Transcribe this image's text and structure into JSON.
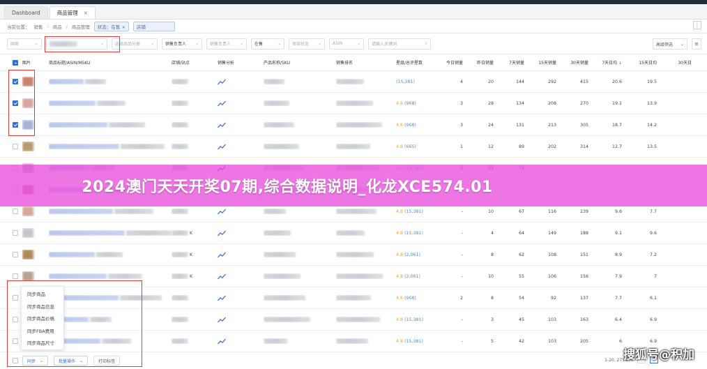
{
  "tabs": [
    {
      "label": "Dashboard",
      "active": false
    },
    {
      "label": "商品管理",
      "active": true,
      "close": "×"
    }
  ],
  "breadcrumb": {
    "items": [
      "当前位置：",
      "销售",
      "/",
      "商品",
      "/",
      "商品管理"
    ],
    "chips": [
      "状态：在售 ×",
      "店铺"
    ]
  },
  "filters": {
    "site_placeholder": "国家",
    "store_placeholder": "",
    "category_placeholder": "选择商品分类",
    "sales_owner": "销售负责人",
    "product_owner": "销售负责人",
    "status": "在售",
    "review_status": "审核状态",
    "asin_label": "ASIN",
    "search_placeholder": "请输入关键词",
    "advanced": "高级筛选",
    "menu_icon": "≡"
  },
  "table": {
    "headers": {
      "image": "图片",
      "title": "商品标题/ASIN/MSKU",
      "store": "店铺/站点",
      "sales_analysis": "销售分析",
      "product_sku": "产品名称/SKU",
      "sales_rank": "销售排名",
      "rating": "星级/总评星数",
      "today": "今日销量",
      "yesterday": "昨日销量",
      "d7": "7天销量",
      "d15": "15天销量",
      "d30": "30天销量",
      "daily7": "7天日均",
      "daily15": "15天日均",
      "daily30": "30天日"
    },
    "rows": [
      {
        "checked": true,
        "rating": "",
        "count": "(15,381)",
        "today": "4",
        "yesterday": "20",
        "d7": "144",
        "d15": "292",
        "d30": "415",
        "daily7": "20.6",
        "daily15": "19.5",
        "store_suffix": "",
        "thumb": "#c9826e"
      },
      {
        "checked": true,
        "rating": "4.6",
        "count": "(968)",
        "today": "3",
        "yesterday": "28",
        "d7": "134",
        "d15": "208",
        "d30": "270",
        "daily7": "19.1",
        "daily15": "13.9",
        "store_suffix": "",
        "thumb": "#d8a6a0"
      },
      {
        "checked": true,
        "rating": "4.6",
        "count": "(968)",
        "today": "3",
        "yesterday": "24",
        "d7": "131",
        "d15": "213",
        "d30": "305",
        "daily7": "18.7",
        "daily15": "14.2",
        "store_suffix": "",
        "thumb": "#a7b4d8"
      },
      {
        "checked": false,
        "rating": "4.8",
        "count": "(665)",
        "today": "1",
        "yesterday": "12",
        "d7": "89",
        "d15": "202",
        "d30": "314",
        "daily7": "12.7",
        "daily15": "13.5",
        "store_suffix": "",
        "thumb": "#b79a6a"
      },
      {
        "checked": false,
        "rating": "4.8",
        "count": "(15,381)",
        "today": "1",
        "yesterday": "11",
        "d7": "75",
        "d15": "",
        "d30": "",
        "daily7": "",
        "daily15": "",
        "store_suffix": "",
        "thumb": "#cfa7b3"
      },
      {
        "checked": false,
        "rating": "",
        "count": "",
        "today": "",
        "yesterday": "",
        "d7": "",
        "d15": "",
        "d30": "",
        "daily7": "",
        "daily15": "",
        "store_suffix": "",
        "thumb": "#d07b92"
      },
      {
        "checked": false,
        "rating": "4.8",
        "count": "(15,381)",
        "today": "-",
        "yesterday": "10",
        "d7": "67",
        "d15": "116",
        "d30": "239",
        "daily7": "9.6",
        "daily15": "7.7",
        "store_suffix": "",
        "thumb": "#d5a89a"
      },
      {
        "checked": false,
        "rating": "4.8",
        "count": "(15,381)",
        "today": "-",
        "yesterday": "4",
        "d7": "64",
        "d15": "149",
        "d30": "188",
        "daily7": "9.1",
        "daily15": "9.6",
        "store_suffix": "K",
        "thumb": "#c3c6cd"
      },
      {
        "checked": false,
        "rating": "4.8",
        "count": "(2,061)",
        "today": "-",
        "yesterday": "8",
        "d7": "62",
        "d15": "108",
        "d30": "151",
        "daily7": "8.9",
        "daily15": "7.2",
        "store_suffix": "K",
        "thumb": "#b08a54"
      },
      {
        "checked": false,
        "rating": "4.8",
        "count": "(2,061)",
        "today": "-",
        "yesterday": "10",
        "d7": "55",
        "d15": "106",
        "d30": "156",
        "daily7": "7.9",
        "daily15": "7",
        "store_suffix": "K",
        "thumb": "#b9a48e"
      },
      {
        "checked": false,
        "rating": "4.6",
        "count": "(968)",
        "today": "2",
        "yesterday": "8",
        "d7": "54",
        "d15": "92",
        "d30": "137",
        "daily7": "7.7",
        "daily15": "6.1",
        "store_suffix": "",
        "thumb": "#c79a8a"
      },
      {
        "checked": false,
        "rating": "4.8",
        "count": "(15,381)",
        "today": "-",
        "yesterday": "3",
        "d7": "45",
        "d15": "103",
        "d30": "163",
        "daily7": "6.4",
        "daily15": "6.9",
        "store_suffix": "",
        "thumb": "#c2b5a4"
      },
      {
        "checked": false,
        "rating": "4.8",
        "count": "(15,381)",
        "today": "-",
        "yesterday": "5",
        "d7": "42",
        "d15": "103",
        "d30": "205",
        "daily7": "6",
        "daily15": "6.9",
        "store_suffix": "",
        "thumb": "#cbb09d"
      }
    ]
  },
  "sync_menu": [
    "同步商品",
    "同步商品信息",
    "同步商品价格",
    "同步FBA费用",
    "同步商品尺寸"
  ],
  "footer": {
    "sync": "同步",
    "batch": "批量操作",
    "print": "打印标签",
    "total": "1-20, 273条共",
    "page": "1"
  },
  "banner": "2024澳门天天开奖07期,综合数据说明_化龙XCE574.01",
  "watermark": "搜狐号@积加"
}
